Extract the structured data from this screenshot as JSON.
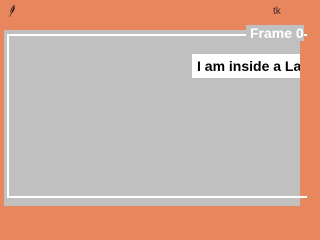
{
  "window": {
    "title": "tk",
    "icon": "feather-icon"
  },
  "frame": {
    "label": "Frame 0"
  },
  "content": {
    "label_text": "I am inside a La"
  },
  "colors": {
    "window_bg": "#e8865e",
    "frame_bg": "#c0c0c0",
    "border": "#ffffff",
    "label_bg": "#ffffff"
  }
}
